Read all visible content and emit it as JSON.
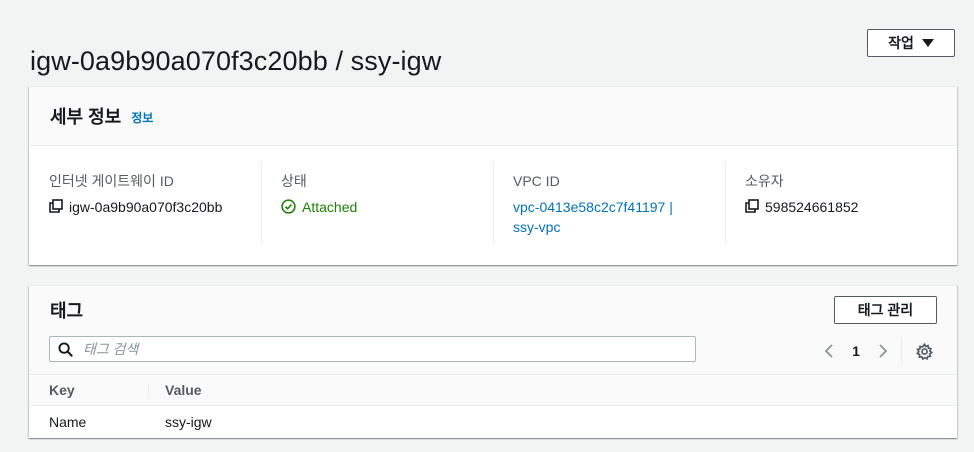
{
  "header": {
    "title": "igw-0a9b90a070f3c20bb / ssy-igw",
    "actions_label": "작업"
  },
  "details": {
    "title": "세부 정보",
    "info_link": "정보",
    "fields": [
      {
        "label": "인터넷 게이트웨이 ID",
        "value": "igw-0a9b90a070f3c20bb"
      },
      {
        "label": "상태",
        "value": "Attached"
      },
      {
        "label": "VPC ID",
        "value_line1": "vpc-0413e58c2c7f41197 |",
        "value_line2": "ssy-vpc"
      },
      {
        "label": "소유자",
        "value": "598524661852"
      }
    ]
  },
  "tags": {
    "title": "태그",
    "manage_label": "태그 관리",
    "search_placeholder": "태그 검색",
    "current_page": "1",
    "columns": [
      "Key",
      "Value"
    ],
    "rows": [
      {
        "key": "Name",
        "value": "ssy-igw"
      }
    ]
  },
  "colors": {
    "link": "#0073bb",
    "success": "#1d8102",
    "background": "#f2f3f3"
  },
  "icons": {
    "copy": "copy-icon",
    "status": "check-circle-icon",
    "search": "search-icon",
    "prev": "chevron-left-icon",
    "next": "chevron-right-icon",
    "settings": "gear-icon",
    "dropdown": "caret-down-icon"
  }
}
